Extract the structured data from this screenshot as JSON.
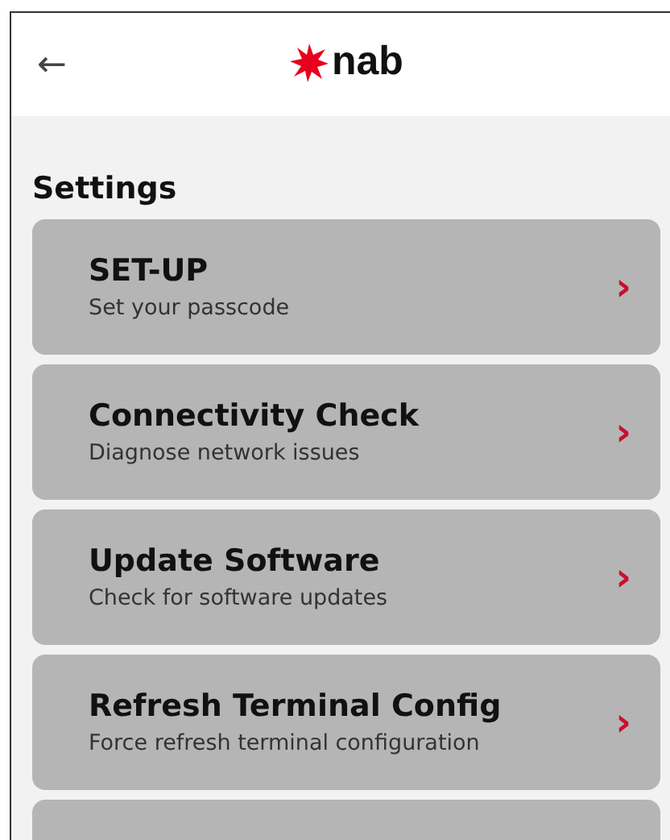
{
  "header": {
    "back": "←",
    "logo_text": "nab"
  },
  "title": "Settings",
  "items": [
    {
      "kind": "entry",
      "title": "SET-UP",
      "subtitle": "Set your passcode",
      "chevron": "›"
    },
    {
      "kind": "entry",
      "title": "Connectivity Check",
      "subtitle": "Diagnose network issues",
      "chevron": "›"
    },
    {
      "kind": "entry",
      "title": "Update Software",
      "subtitle": "Check for software updates",
      "chevron": "›"
    },
    {
      "kind": "entry",
      "title": "Refresh Terminal Config",
      "subtitle": "Force refresh terminal configuration",
      "chevron": "›"
    },
    {
      "kind": "partial"
    }
  ]
}
